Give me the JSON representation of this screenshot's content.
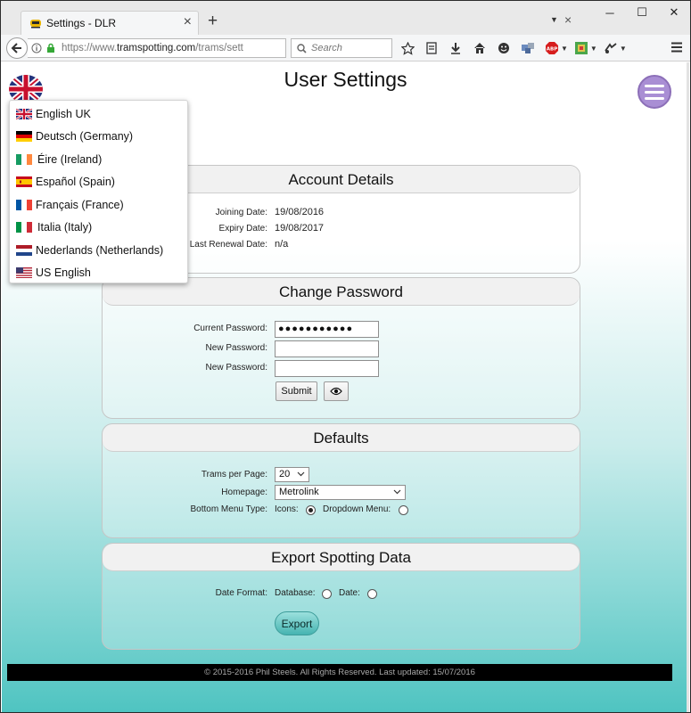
{
  "browser": {
    "tab_title": "Settings - DLR",
    "url_prefix": "https://www.",
    "url_host": "tramspotting.com",
    "url_path": "/trams/sett",
    "search_placeholder": "Search",
    "abp_label": "ABP"
  },
  "page": {
    "title": "User Settings"
  },
  "languages": [
    {
      "label": "English UK",
      "flag": "uk-flag-icon"
    },
    {
      "label": "Deutsch (Germany)",
      "flag": "germany-flag-icon"
    },
    {
      "label": "Éire (Ireland)",
      "flag": "ireland-flag-icon"
    },
    {
      "label": "Español (Spain)",
      "flag": "spain-flag-icon"
    },
    {
      "label": "Français (France)",
      "flag": "france-flag-icon"
    },
    {
      "label": "Italia (Italy)",
      "flag": "italy-flag-icon"
    },
    {
      "label": "Nederlands (Netherlands)",
      "flag": "netherlands-flag-icon"
    },
    {
      "label": "US English",
      "flag": "us-flag-icon"
    }
  ],
  "account": {
    "header": "Account Details",
    "joining_label": "Joining Date:",
    "joining_value": "19/08/2016",
    "expiry_label": "Expiry Date:",
    "expiry_value": "19/08/2017",
    "renewal_label": "Last Renewal Date:",
    "renewal_value": "n/a"
  },
  "password": {
    "header": "Change Password",
    "current_label": "Current Password:",
    "current_value": "●●●●●●●●●●●",
    "new_label": "New Password:",
    "new_label_2": "New Password:",
    "submit_label": "Submit"
  },
  "defaults": {
    "header": "Defaults",
    "trams_label": "Trams per Page:",
    "trams_value": "20",
    "homepage_label": "Homepage:",
    "homepage_value": "Metrolink",
    "bottom_menu_label": "Bottom Menu Type:",
    "icons_label": "Icons:",
    "dropdown_label": "Dropdown Menu:",
    "selected_menu_type": "Icons"
  },
  "export": {
    "header": "Export Spotting Data",
    "date_format_label": "Date Format:",
    "database_label": "Database:",
    "date_label": "Date:",
    "export_label": "Export"
  },
  "footer": {
    "text": "© 2015-2016 Phil Steels. All Rights Reserved.      Last updated: 15/07/2016"
  },
  "colors": {
    "accent_purple": "#a98ed4",
    "teal_gradient_end": "#4fc4c1",
    "footer_bg": "#000000"
  }
}
